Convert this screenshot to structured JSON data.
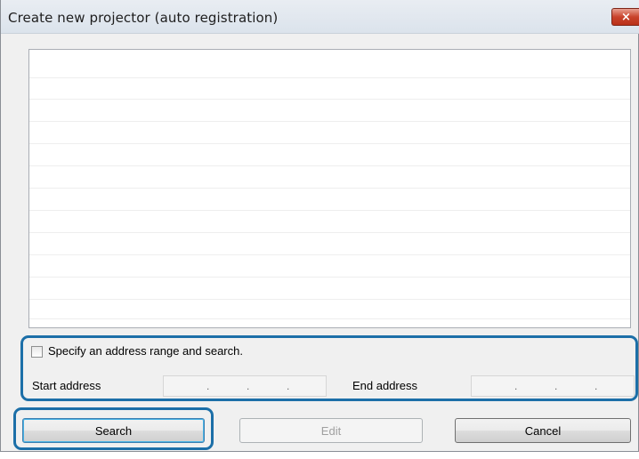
{
  "window": {
    "title": "Create new projector (auto registration)",
    "close_glyph": "×"
  },
  "list": {
    "rows": []
  },
  "range": {
    "checkbox_label": "Specify an address range and search.",
    "checked": false,
    "start_label": "Start address",
    "end_label": "End address",
    "start_value": "",
    "end_value": ""
  },
  "buttons": {
    "search": "Search",
    "edit": "Edit",
    "cancel": "Cancel"
  },
  "colors": {
    "highlight_outline": "#1c6fa8",
    "close_button": "#c9432c"
  },
  "icons": {
    "close": "close-icon"
  }
}
